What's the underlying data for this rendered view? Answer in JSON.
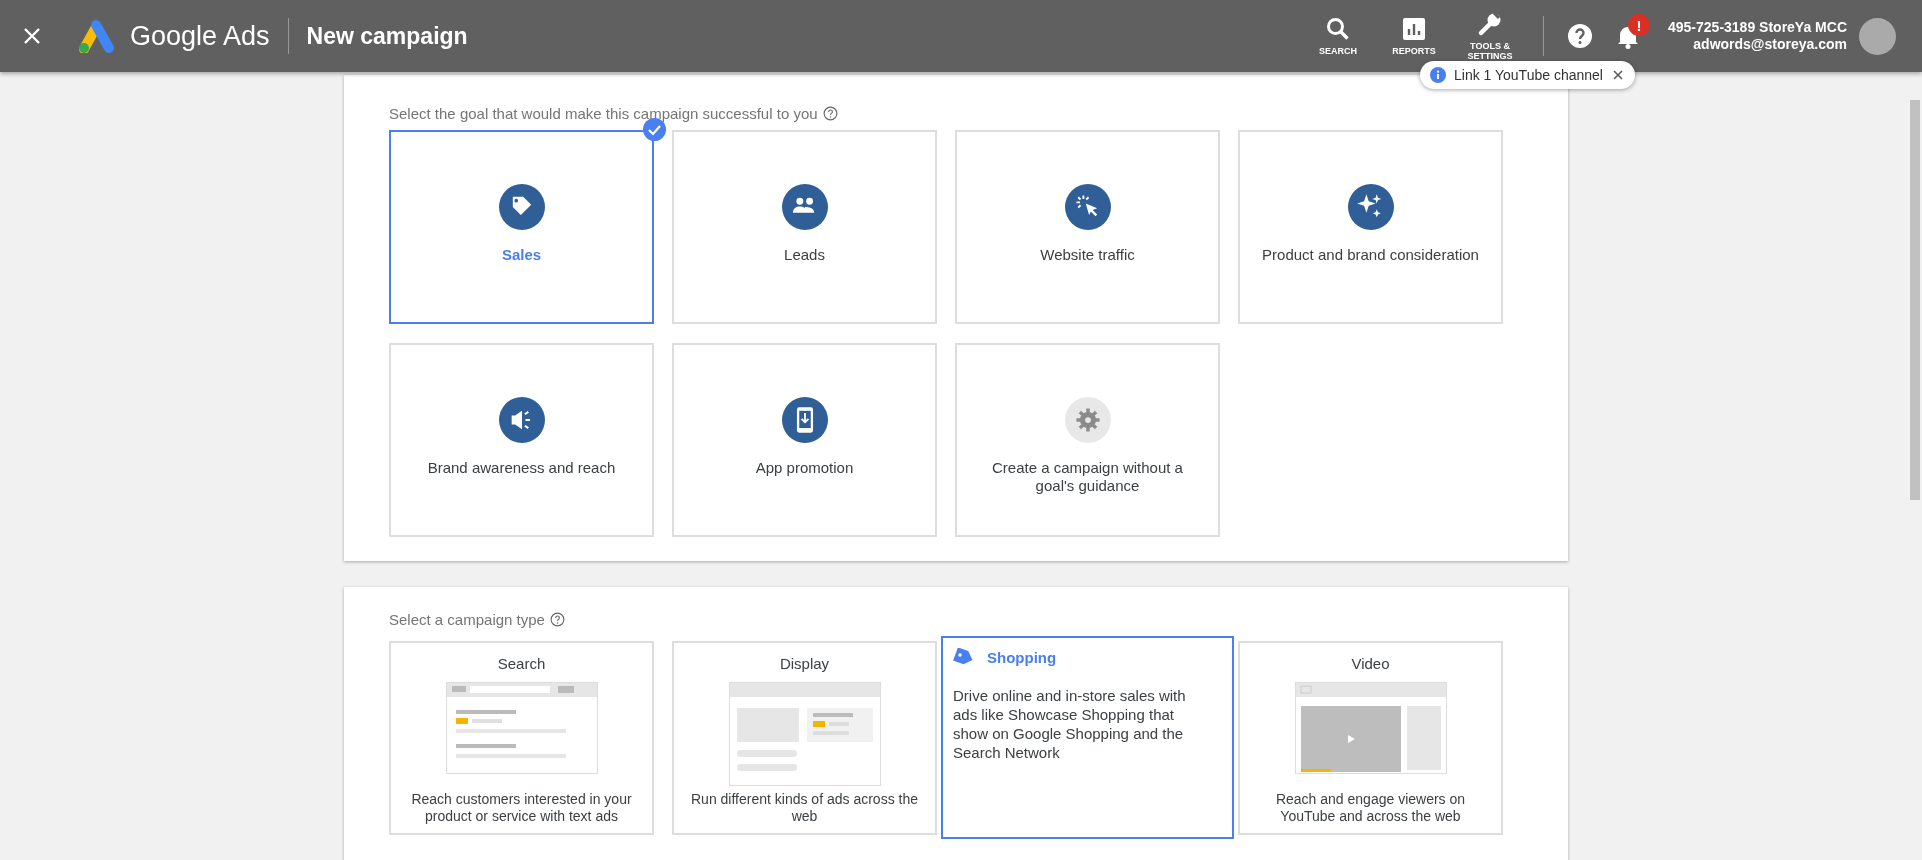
{
  "header": {
    "product": "Google Ads",
    "title": "New campaign",
    "nav": [
      {
        "label": "SEARCH"
      },
      {
        "label": "REPORTS"
      },
      {
        "label": "TOOLS & SETTINGS"
      }
    ],
    "notification_badge": "!",
    "account_name": "495-725-3189 StoreYa MCC",
    "account_email": "adwords@storeya.com"
  },
  "tooltip": {
    "text": "Link 1 YouTube channel"
  },
  "goals": {
    "prompt": "Select the goal that would make this campaign successful to you",
    "items": [
      {
        "label": "Sales",
        "selected": true,
        "kind": "goal"
      },
      {
        "label": "Leads",
        "selected": false,
        "kind": "goal"
      },
      {
        "label": "Website traffic",
        "selected": false,
        "kind": "goal"
      },
      {
        "label": "Product and brand consideration",
        "selected": false,
        "kind": "goal"
      },
      {
        "label": "Brand awareness and reach",
        "selected": false,
        "kind": "goal"
      },
      {
        "label": "App promotion",
        "selected": false,
        "kind": "goal"
      },
      {
        "label": "Create a campaign without a goal's guidance",
        "selected": false,
        "kind": "no-goal"
      }
    ]
  },
  "campaign_types": {
    "prompt": "Select a campaign type",
    "items": [
      {
        "label": "Search",
        "description": "Reach customers interested in your product or service with text ads",
        "selected": false
      },
      {
        "label": "Display",
        "description": "Run different kinds of ads across the web",
        "selected": false
      },
      {
        "label": "Shopping",
        "description": "Drive online and in-store sales with ads like Showcase Shopping that show on Google Shopping and the Search Network",
        "selected": true
      },
      {
        "label": "Video",
        "description": "Reach and engage viewers on YouTube and across the web",
        "selected": false
      }
    ]
  }
}
